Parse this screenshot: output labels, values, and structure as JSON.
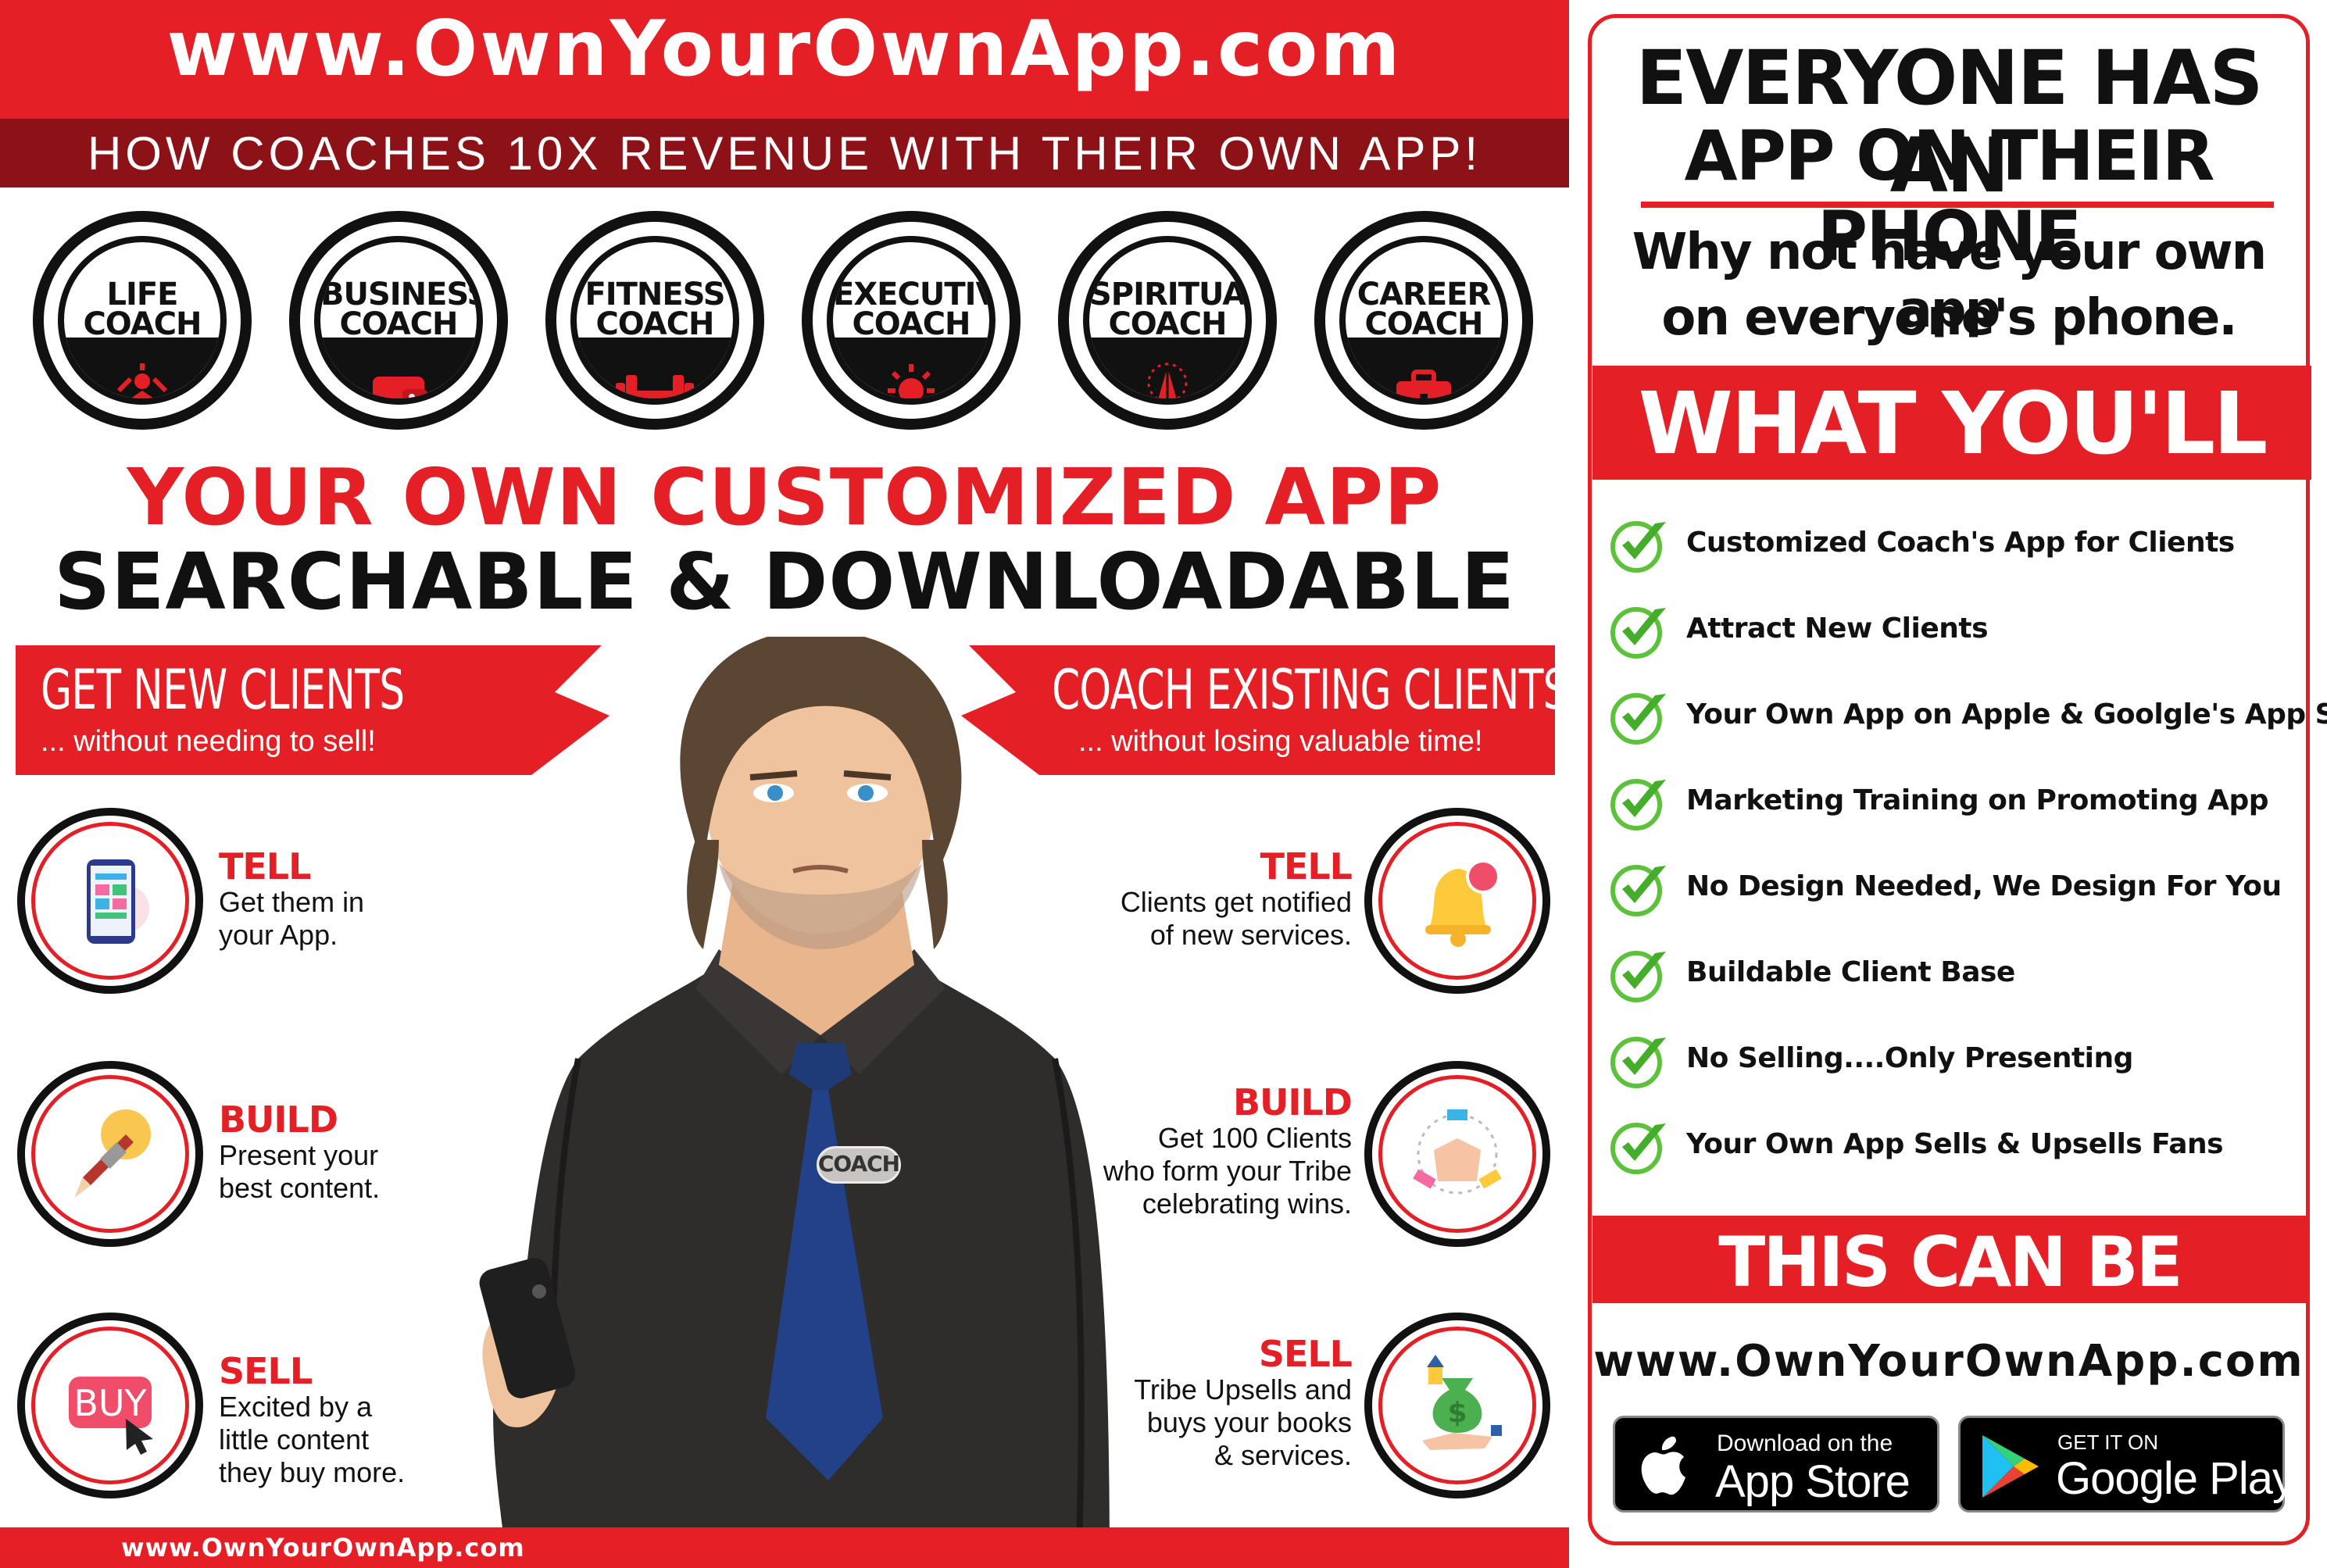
{
  "left": {
    "header_url": "www.OwnYourOwnApp.com",
    "subheader": "HOW COACHES 10X REVENUE WITH THEIR OWN APP!",
    "coaches": [
      {
        "line1": "LIFE",
        "line2": "COACH",
        "icon": "person-icon"
      },
      {
        "line1": "BUSINESS",
        "line2": "COACH",
        "icon": "wallet-icon"
      },
      {
        "line1": "FITNESS",
        "line2": "COACH",
        "icon": "dumbbell-icon"
      },
      {
        "line1": "EXECUTIVE",
        "line2": "COACH",
        "icon": "lightbulb-icon"
      },
      {
        "line1": "SPIRITUAL",
        "line2": "COACH",
        "icon": "praying-hands-icon"
      },
      {
        "line1": "CAREER",
        "line2": "COACH",
        "icon": "briefcase-icon"
      }
    ],
    "headline1": "YOUR OWN CUSTOMIZED APP",
    "headline2": "SEARCHABLE & DOWNLOADABLE",
    "banner_left_title": "GET NEW CLIENTS",
    "banner_left_sub": "... without needing to sell!",
    "banner_right_title": "COACH EXISTING CLIENTS",
    "banner_right_sub": "... without losing valuable time!",
    "badge": "COACH",
    "left_steps": [
      {
        "title": "TELL",
        "line1": "Get them in",
        "line2": "your App.",
        "line3": ""
      },
      {
        "title": "BUILD",
        "line1": "Present your",
        "line2": "best content.",
        "line3": ""
      },
      {
        "title": "SELL",
        "line1": "Excited by a",
        "line2": "little content",
        "line3": "they buy more."
      }
    ],
    "right_steps": [
      {
        "title": "TELL",
        "line1": "Clients get notified",
        "line2": "of new services.",
        "line3": ""
      },
      {
        "title": "BUILD",
        "line1": "Get 100 Clients",
        "line2": "who form your Tribe",
        "line3": "celebrating wins."
      },
      {
        "title": "SELL",
        "line1": "Tribe Upsells and",
        "line2": "buys your books",
        "line3": "& services."
      }
    ],
    "buy_label": "BUY",
    "notification_count": "1",
    "footer_url": "www.OwnYourOwnApp.com"
  },
  "right": {
    "title_line1": "EVERYONE HAS AN",
    "title_line2": "APP ON THEIR PHONE",
    "sub_line1": "Why not have your own app",
    "sub_line2": "on everyone's phone.",
    "get_title": "WHAT YOU'LL GET",
    "benefits": [
      "Customized Coach's App for Clients",
      "Attract New Clients",
      "Your Own App on Apple & Goolgle's App Stores",
      "Marketing Training on Promoting App",
      "No Design Needed, We Design For You",
      "Buildable Client Base",
      "No Selling....Only Presenting",
      "Your Own App Sells & Upsells Fans"
    ],
    "cta": "THIS CAN BE YOU!!!",
    "url": "www.OwnYourOwnApp.com",
    "appstore_small": "Download on the",
    "appstore_big": "App Store",
    "play_small": "GET IT ON",
    "play_big": "Google Play"
  },
  "colors": {
    "accent": "#e41f26",
    "dark_red": "#8d1217",
    "text": "#111111"
  }
}
